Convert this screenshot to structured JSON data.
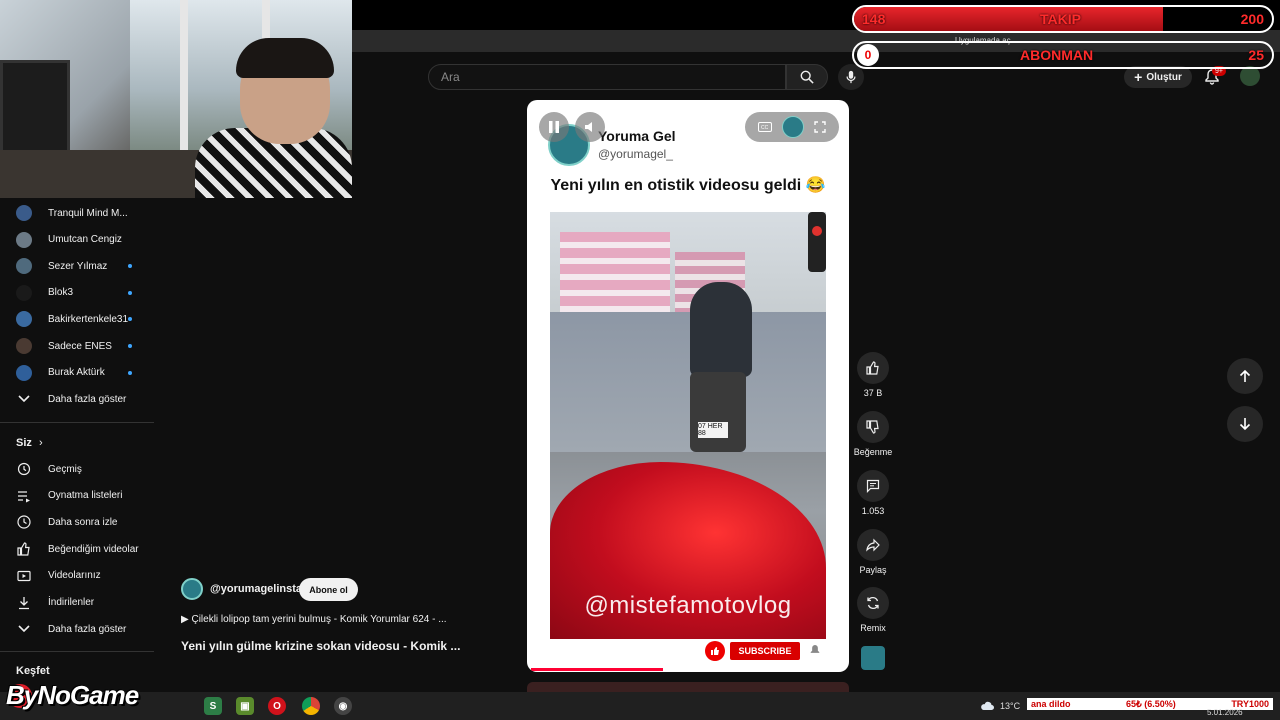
{
  "overlay": {
    "takip_current": "148",
    "takip_label": "TAKIP",
    "takip_goal": "200",
    "takip_fraction": 0.74,
    "abone_current": "0",
    "abone_label": "ABONMAN",
    "abone_goal": "25",
    "abone_fraction": 0.0,
    "extension_text": "Uygulamada aç"
  },
  "header": {
    "search_placeholder": "Ara",
    "create_label": "Oluştur",
    "bell_badge": "9+"
  },
  "sidebar": {
    "subscriptions": [
      {
        "label": "Tranquil Mind M...",
        "color": "#3a5b8a",
        "dot": false
      },
      {
        "label": "Umutcan Cengiz",
        "color": "#6c7a86",
        "dot": false
      },
      {
        "label": "Sezer Yılmaz",
        "color": "#4f6a7d",
        "dot": true
      },
      {
        "label": "Blok3",
        "color": "#1a1a1a",
        "dot": true
      },
      {
        "label": "Bakirkertenkele31",
        "color": "#3a6aa0",
        "dot": true
      },
      {
        "label": "Sadece ENES",
        "color": "#4a3a32",
        "dot": true
      },
      {
        "label": "Burak Aktürk",
        "color": "#2f5f9a",
        "dot": true
      }
    ],
    "more_subs": "Daha fazla göster",
    "you_label": "Siz",
    "you_items": [
      {
        "label": "Geçmiş",
        "icon": "history-icon"
      },
      {
        "label": "Oynatma listeleri",
        "icon": "playlist-icon"
      },
      {
        "label": "Daha sonra izle",
        "icon": "watch-later-icon"
      },
      {
        "label": "Beğendiğim videolar",
        "icon": "liked-videos-icon"
      },
      {
        "label": "Videolarınız",
        "icon": "your-videos-icon"
      },
      {
        "label": "İndirilenler",
        "icon": "download-icon"
      }
    ],
    "more_you": "Daha fazla göster",
    "explore_label": "Keşfet"
  },
  "short": {
    "channel_name": "Yoruma Gel",
    "channel_handle": "@yorumagel_",
    "card_title": "Yeni yılın en otistik videosu geldi 😂",
    "plate_text": "07 HER 88",
    "watermark": "@mistefamotovlog",
    "subscribe_label": "SUBSCRIBE",
    "progress_fraction": 0.42
  },
  "below": {
    "channel_handle": "@yorumagelinsta",
    "subscribe_label": "Abone ol",
    "playlist_line": "▶ Çilekli lolipop tam yerini bulmuş - Komik Yorumlar 624 - ...",
    "video_title": "Yeni yılın gülme krizine sokan videosu - Komik ..."
  },
  "rail": {
    "like_count": "37 B",
    "dislike_label": "Beğenme",
    "comment_count": "1.053",
    "share_label": "Paylaş",
    "remix_label": "Remix"
  },
  "taskbar": {
    "brand": "ByNoGame",
    "temperature": "13°C",
    "ticker_left": "ana dildo",
    "ticker_change": "65₺ (6.50%)",
    "ticker_symbol": "TRY1000",
    "date": "5.01.2026"
  },
  "colors": {
    "accent_red": "#ff0033",
    "overlay_red": "#e8262b",
    "link_blue": "#3ea6ff"
  }
}
